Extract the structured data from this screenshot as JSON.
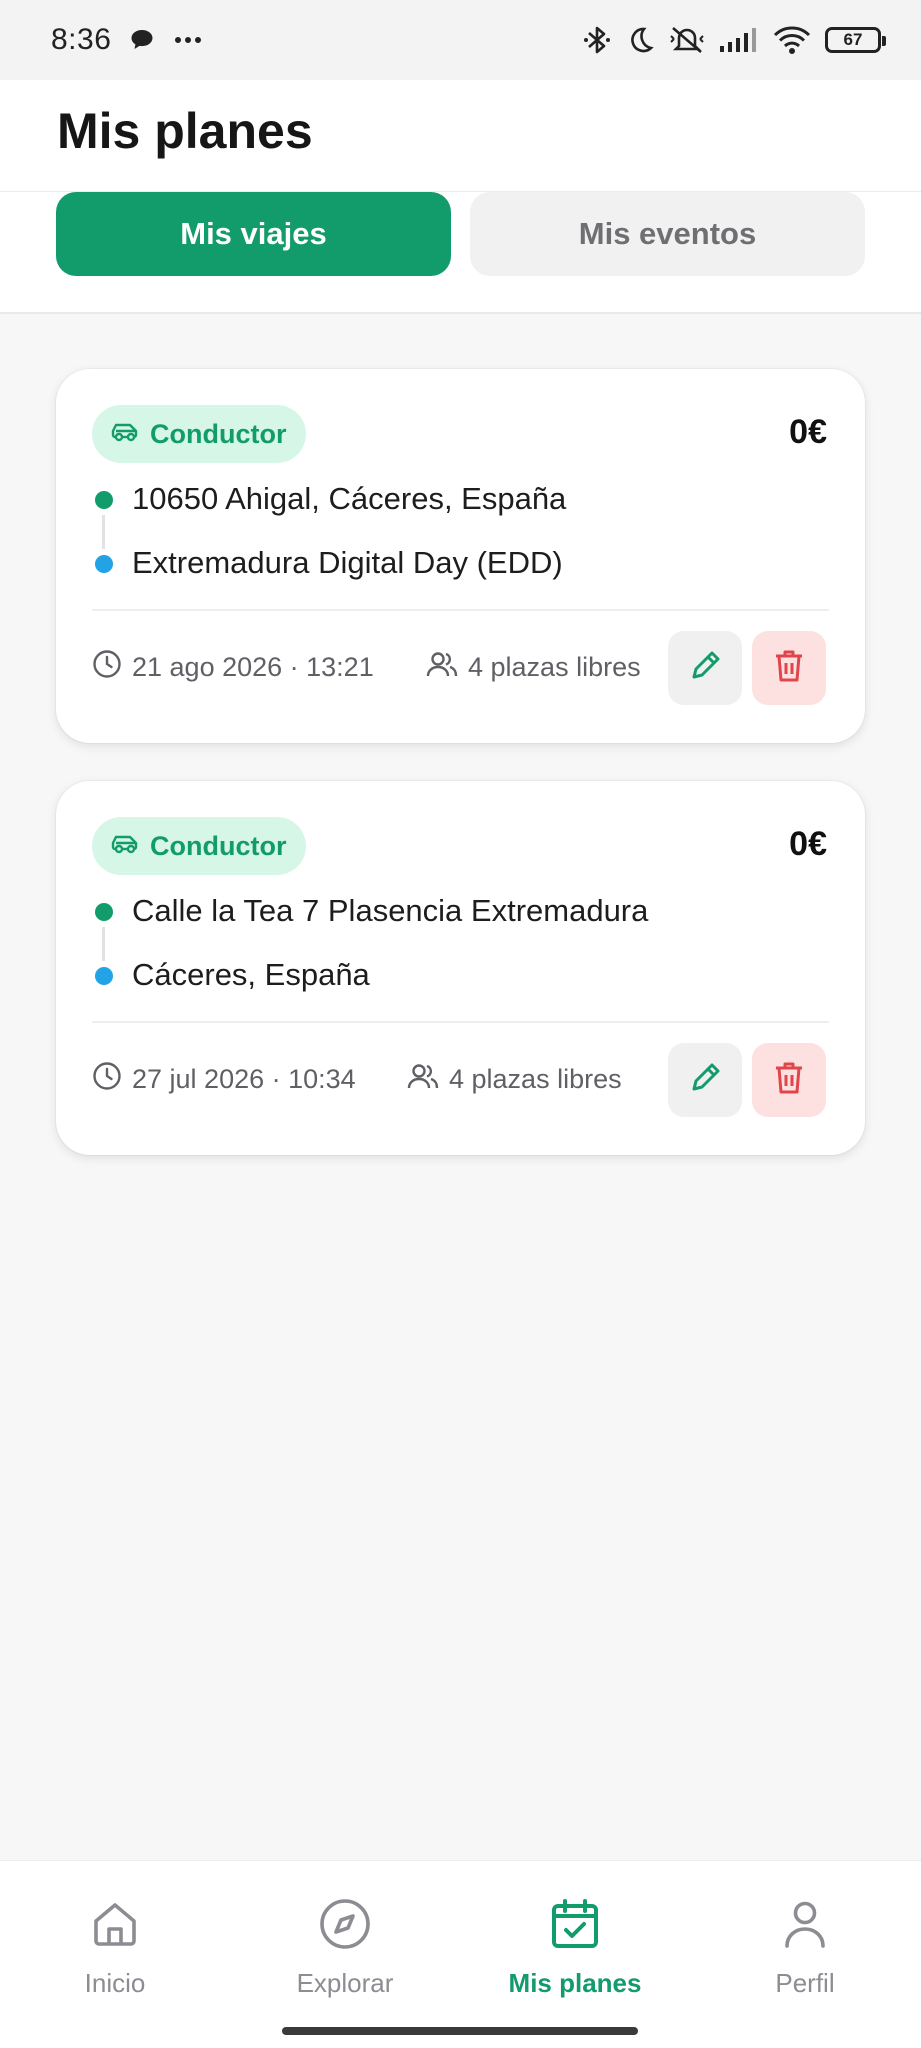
{
  "status_bar": {
    "time": "8:36",
    "battery_level": "67",
    "icons": [
      "chat-bubble-icon",
      "more-dots-icon",
      "bluetooth-icon",
      "moon-icon",
      "mute-icon",
      "signal-icon",
      "wifi-icon",
      "battery-icon"
    ]
  },
  "header": {
    "title": "Mis planes"
  },
  "tabs": [
    {
      "label": "Mis viajes",
      "active": true
    },
    {
      "label": "Mis eventos",
      "active": false
    }
  ],
  "trips": [
    {
      "role": "Conductor",
      "price": "0€",
      "origin": "10650 Ahigal, Cáceres, España",
      "destination": "Extremadura Digital Day (EDD)",
      "datetime": "21 ago 2026 · 13:21",
      "seats": "4 plazas libres"
    },
    {
      "role": "Conductor",
      "price": "0€",
      "origin": "Calle la Tea 7 Plasencia Extremadura",
      "destination": "Cáceres, España",
      "datetime": "27 jul 2026 · 10:34",
      "seats": "4 plazas libres"
    }
  ],
  "nav": [
    {
      "label": "Inicio",
      "icon": "home-icon",
      "active": false
    },
    {
      "label": "Explorar",
      "icon": "compass-icon",
      "active": false
    },
    {
      "label": "Mis planes",
      "icon": "calendar-check-icon",
      "active": true
    },
    {
      "label": "Perfil",
      "icon": "user-icon",
      "active": false
    }
  ],
  "colors": {
    "accent": "#139c6b",
    "badge_bg": "#d6f6e7",
    "destination_dot": "#22a3e6",
    "delete": "#e0454b",
    "delete_bg": "#fde1e1"
  }
}
